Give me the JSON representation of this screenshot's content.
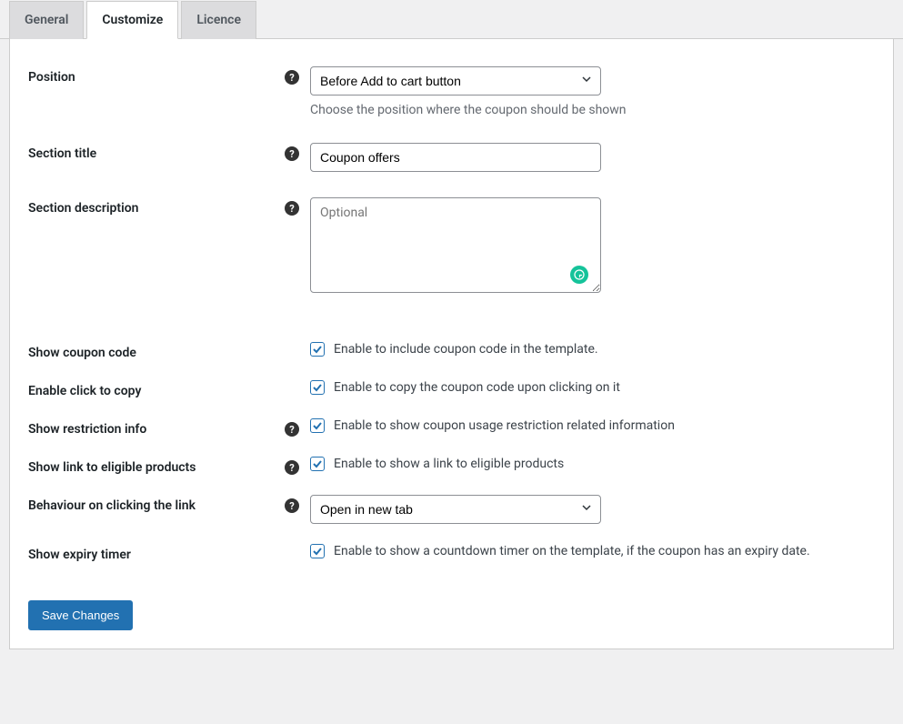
{
  "tabs": {
    "general": "General",
    "customize": "Customize",
    "licence": "Licence"
  },
  "fields": {
    "position": {
      "label": "Position",
      "value": "Before Add to cart button",
      "desc": "Choose the position where the coupon should be shown"
    },
    "section_title": {
      "label": "Section title",
      "value": "Coupon offers"
    },
    "section_description": {
      "label": "Section description",
      "placeholder": "Optional",
      "value": ""
    },
    "show_coupon_code": {
      "label": "Show coupon code",
      "checkbox_label": "Enable to include coupon code in the template."
    },
    "enable_click_to_copy": {
      "label": "Enable click to copy",
      "checkbox_label": "Enable to copy the coupon code upon clicking on it"
    },
    "show_restriction_info": {
      "label": "Show restriction info",
      "checkbox_label": "Enable to show coupon usage restriction related information"
    },
    "show_link_eligible": {
      "label": "Show link to eligible products",
      "checkbox_label": "Enable to show a link to eligible products"
    },
    "behaviour_link": {
      "label": "Behaviour on clicking the link",
      "value": "Open in new tab"
    },
    "show_expiry_timer": {
      "label": "Show expiry timer",
      "checkbox_label": "Enable to show a countdown timer on the template, if the coupon has an expiry date."
    }
  },
  "buttons": {
    "save": "Save Changes"
  }
}
